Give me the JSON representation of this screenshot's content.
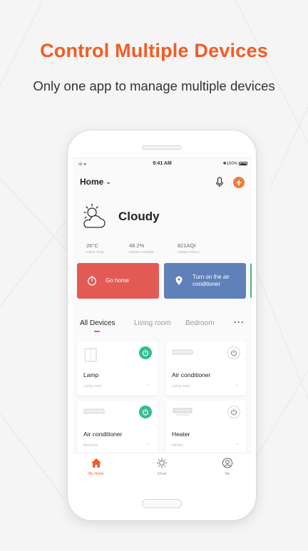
{
  "headline": "Control Multiple Devices",
  "subheadline": "Only one app to manage multiple devices",
  "status_bar": {
    "signal": "ııl ᯤ",
    "time": "9:41 AM",
    "battery": "✱100%"
  },
  "header": {
    "title": "Home",
    "mic_icon": "microphone-icon",
    "add_icon": "plus-icon",
    "add_label": "+"
  },
  "weather": {
    "condition": "Cloudy",
    "icon": "cloudy-sun-icon",
    "stats": [
      {
        "value": "26°C",
        "label": "Indoor Temp"
      },
      {
        "value": "48.2%",
        "label": "Outdoor Humidity"
      },
      {
        "value": "821AQI",
        "label": "Outdoor PM2.5"
      }
    ]
  },
  "scenes": [
    {
      "label": "Go home",
      "icon": "timer-icon",
      "color": "#e35a54"
    },
    {
      "label": "Turn on the air conditioner",
      "icon": "location-pin-icon",
      "color": "#5f80b8"
    }
  ],
  "tabs": [
    {
      "label": "All Devices",
      "active": true
    },
    {
      "label": "Living room",
      "active": false
    },
    {
      "label": "Bedroom",
      "active": false
    }
  ],
  "more_label": "···",
  "devices": [
    {
      "name": "Lamp",
      "room": "Living room",
      "on": true,
      "icon": "lamp-icon"
    },
    {
      "name": "Air conditioner",
      "room": "Living room",
      "on": false,
      "icon": "air-conditioner-icon"
    },
    {
      "name": "Air conditioner",
      "room": "Bedroom",
      "on": true,
      "icon": "air-conditioner-icon"
    },
    {
      "name": "Heater",
      "room": "kitchen",
      "on": false,
      "icon": "heater-icon"
    }
  ],
  "nav": [
    {
      "label": "My Home",
      "icon": "home-icon",
      "active": true
    },
    {
      "label": "Smart",
      "icon": "sun-icon",
      "active": false
    },
    {
      "label": "Me",
      "icon": "user-icon",
      "active": false
    }
  ],
  "colors": {
    "accent": "#f25c24",
    "power_on": "#2fbf8a"
  }
}
